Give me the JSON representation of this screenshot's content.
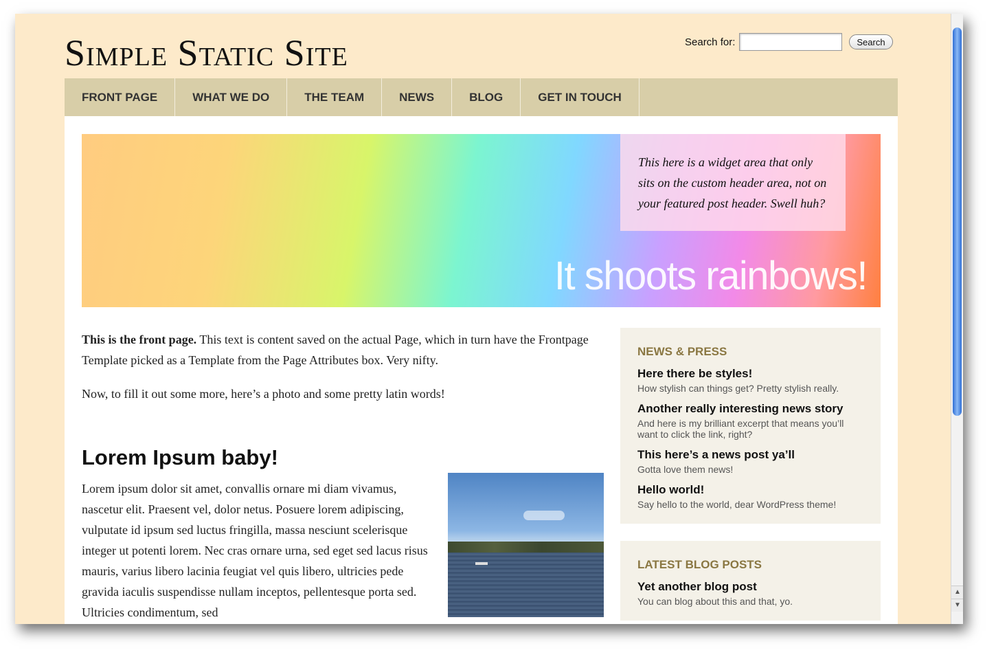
{
  "site": {
    "title": "Simple Static Site"
  },
  "search": {
    "label": "Search for:",
    "value": "",
    "button": "Search"
  },
  "nav": [
    {
      "label": "FRONT PAGE"
    },
    {
      "label": "WHAT WE DO"
    },
    {
      "label": "THE TEAM"
    },
    {
      "label": "NEWS"
    },
    {
      "label": "BLOG"
    },
    {
      "label": "GET IN TOUCH"
    }
  ],
  "hero": {
    "widget_text": "This here is a widget area that only sits on the custom header area, not on your featured post header. Swell huh?",
    "tagline": "It shoots rainbows!"
  },
  "main": {
    "intro_bold": "This is the front page.",
    "intro_rest": " This text is content saved on the actual Page, which in turn have the Frontpage Template picked as a Template from the Page Attributes box. Very nifty.",
    "para2": "Now, to fill it out some more, here’s a photo and some pretty latin words!",
    "heading": "Lorem Ipsum baby!",
    "lorem": "Lorem ipsum dolor sit amet, convallis ornare mi diam vivamus, nascetur elit. Praesent vel, dolor netus. Posuere lorem adipiscing, vulputate id ipsum sed luctus fringilla, massa nesciunt scelerisque integer ut potenti lorem. Nec cras ornare urna, sed eget sed lacus risus mauris, varius libero lacinia feugiat vel quis libero, ultricies pede gravida iaculis suspendisse nullam inceptos, pellentesque porta sed. Ultricies condimentum, sed"
  },
  "sidebar": {
    "news": {
      "title": "NEWS & PRESS",
      "items": [
        {
          "title": "Here there be styles!",
          "excerpt": "How stylish can things get? Pretty stylish really."
        },
        {
          "title": "Another really interesting news story",
          "excerpt": "And here is my brilliant excerpt that means you’ll want to click the link, right?"
        },
        {
          "title": "This here’s a news post ya’ll",
          "excerpt": "Gotta love them news!"
        },
        {
          "title": "Hello world!",
          "excerpt": "Say hello to the world, dear WordPress theme!"
        }
      ]
    },
    "blog": {
      "title": "LATEST BLOG POSTS",
      "items": [
        {
          "title": "Yet another blog post",
          "excerpt": "You can blog about this and that, yo."
        }
      ]
    }
  },
  "icons": {
    "scroll_up": "arrow-up-icon",
    "scroll_down": "arrow-down-icon"
  }
}
